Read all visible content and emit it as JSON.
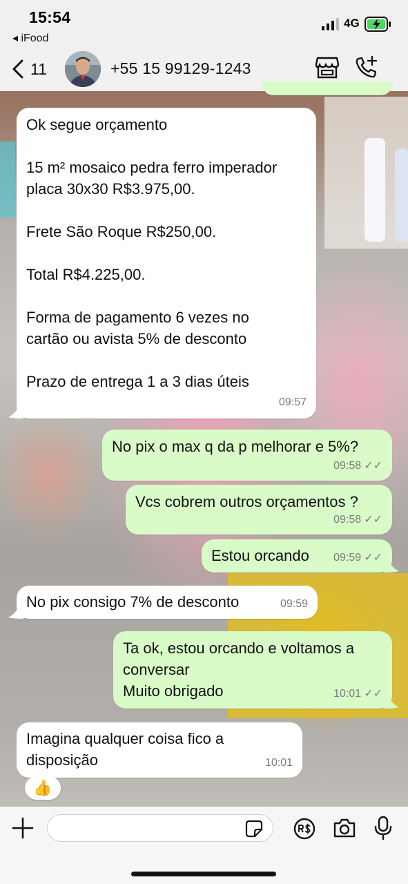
{
  "status_bar": {
    "time": "15:54",
    "back_app": "◂ iFood",
    "network": "4G"
  },
  "header": {
    "back_count": "11",
    "contact": "+55 15 99129-1243",
    "icons": [
      "back-chevron-icon",
      "avatar",
      "store-icon",
      "add-call-icon"
    ]
  },
  "messages": [
    {
      "direction": "in",
      "text": "Ok segue orçamento\n\n15 m² mosaico pedra ferro imperador\nplaca 30x30 R$3.975,00.\n\nFrete São Roque R$250,00.\n\nTotal R$4.225,00.\n\nForma de pagamento 6 vezes no\ncartão ou avista 5% de desconto\n\nPrazo de entrega 1 a 3 dias úteis",
      "time": "09:57"
    },
    {
      "direction": "out",
      "text": "No pix o max q da p melhorar e 5%?",
      "time": "09:58",
      "ticks": "✓✓"
    },
    {
      "direction": "out",
      "text": "Vcs cobrem outros orçamentos ?",
      "time": "09:58",
      "ticks": "✓✓"
    },
    {
      "direction": "out",
      "text": "Estou orcando",
      "time": "09:59",
      "ticks": "✓✓"
    },
    {
      "direction": "in",
      "text": "No pix consigo 7% de desconto",
      "time": "09:59"
    },
    {
      "direction": "out",
      "text": "Ta ok, estou orcando e voltamos a\nconversar\nMuito obrigado",
      "time": "10:01",
      "ticks": "✓✓"
    },
    {
      "direction": "in",
      "text": "Imagina qualquer coisa fico a\ndisposição",
      "time": "10:01"
    }
  ],
  "reaction": "👍",
  "input_bar": {
    "placeholder": "",
    "icons": [
      "plus-icon",
      "sticker-icon",
      "payment-icon",
      "camera-icon",
      "microphone-icon"
    ]
  },
  "colors": {
    "incoming_bubble": "#ffffff",
    "outgoing_bubble": "#d8fbc8",
    "ticks": "#7b7b7b",
    "battery": "#4cd964"
  }
}
